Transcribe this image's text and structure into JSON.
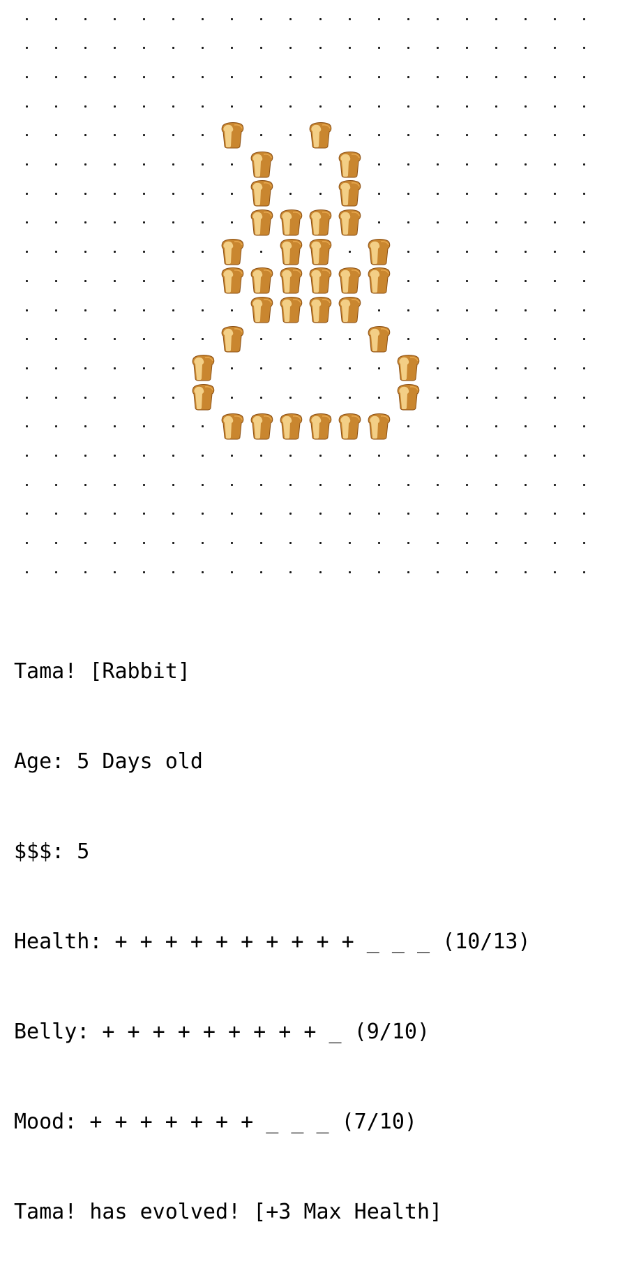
{
  "grid": {
    "cols": 20,
    "rows": 20,
    "empty_glyph": "dot",
    "filled_glyph": "bread-icon",
    "pattern": [
      "....................",
      "....................",
      "....................",
      "....................",
      ".......X..X.........",
      "........X..X........",
      "........X..X........",
      "........XXXX........",
      ".......X.XX.X.......",
      ".......XXXXXX.......",
      "........XXXX........",
      ".......X....X.......",
      "......X......X......",
      "......X......X......",
      ".......XXXXXX.......",
      "....................",
      "....................",
      "....................",
      "....................",
      "...................."
    ]
  },
  "colors": {
    "background": "#ffffff",
    "text": "#000000",
    "dot": "#1a1a1a",
    "bread_crust": "#c9862f",
    "bread_light": "#f3cf86",
    "bread_outline": "#8a4f14"
  },
  "status": {
    "name_line": "Tama! [Rabbit]",
    "age_line": "Age: 5 Days old",
    "money_line": "$$$: 5",
    "health_line": "Health: + + + + + + + + + + _ _ _ (10/13)",
    "belly_line": "Belly: + + + + + + + + + _ (9/10)",
    "mood_line": "Mood: + + + + + + + _ _ _ (7/10)",
    "message_line": "Tama! has evolved! [+3 Max Health]"
  },
  "stats": {
    "health": {
      "current": 10,
      "max": 13
    },
    "belly": {
      "current": 9,
      "max": 10
    },
    "mood": {
      "current": 7,
      "max": 10
    },
    "money": 5,
    "age_days": 5
  }
}
